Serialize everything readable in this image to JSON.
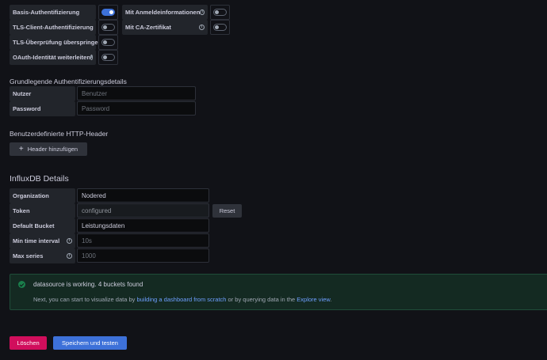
{
  "auth": {
    "left_items": [
      {
        "label": "Basis-Authentifizierung",
        "on": true,
        "info": false
      },
      {
        "label": "TLS-Client-Authentifizierung",
        "on": false,
        "info": false
      },
      {
        "label": "TLS-Überprüfung überspringen",
        "on": false,
        "info": false
      },
      {
        "label": "OAuth-Identität weiterleiten",
        "on": false,
        "info": true
      }
    ],
    "right_items": [
      {
        "label": "Mit Anmeldeinformationen",
        "on": false,
        "info": true
      },
      {
        "label": "Mit CA-Zertifikat",
        "on": false,
        "info": true
      }
    ]
  },
  "basic_auth": {
    "title": "Grundlegende Authentifizierungsdetails",
    "user_label": "Nutzer",
    "user_placeholder": "Benutzer",
    "password_label": "Password",
    "password_placeholder": "Password"
  },
  "headers": {
    "title": "Benutzerdefinierte HTTP-Header",
    "add_button": "Header hinzufügen"
  },
  "influx": {
    "title": "InfluxDB Details",
    "organization_label": "Organization",
    "organization_value": "Nodered",
    "token_label": "Token",
    "token_value": "configured",
    "reset_button": "Reset",
    "bucket_label": "Default Bucket",
    "bucket_value": "Leistungsdaten",
    "min_interval_label": "Min time interval",
    "min_interval_placeholder": "10s",
    "max_series_label": "Max series",
    "max_series_placeholder": "1000"
  },
  "alert": {
    "title": "datasource is working. 4 buckets found",
    "text_1": "Next, you can start to visualize data by ",
    "link_1": "building a dashboard from scratch",
    "text_2": " or by querying data in the ",
    "link_2": "Explore view",
    "text_3": "."
  },
  "actions": {
    "delete": "Löschen",
    "save_test": "Speichern und testen"
  },
  "colors": {
    "background": "#111217",
    "accent": "#3d71d9",
    "danger": "#d10e5c",
    "success_bg": "#142a22",
    "link": "#6e9fff"
  }
}
